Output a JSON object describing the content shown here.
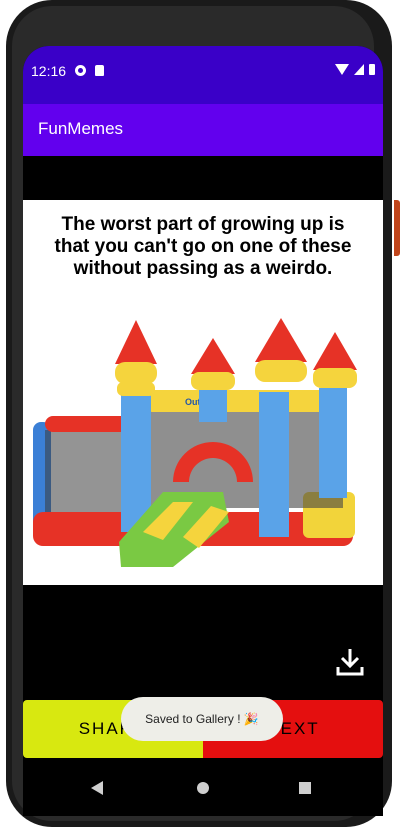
{
  "status_bar": {
    "time": "12:16"
  },
  "app_bar": {
    "title": "FunMemes"
  },
  "meme": {
    "caption": "The worst part of growing up is that you can't go on one of these without passing as a weirdo.",
    "brand_label": "Outsunny"
  },
  "actions": {
    "share_label": "SHARE",
    "next_label": "NEXT"
  },
  "toast": {
    "message": "Saved to Gallery ! 🎉"
  },
  "colors": {
    "status_bar": "#3a00c8",
    "app_bar": "#6200ee",
    "share_button": "#d8e810",
    "next_button": "#e40f0f"
  },
  "icons": [
    "download-icon",
    "back-icon",
    "home-icon",
    "recents-icon"
  ]
}
